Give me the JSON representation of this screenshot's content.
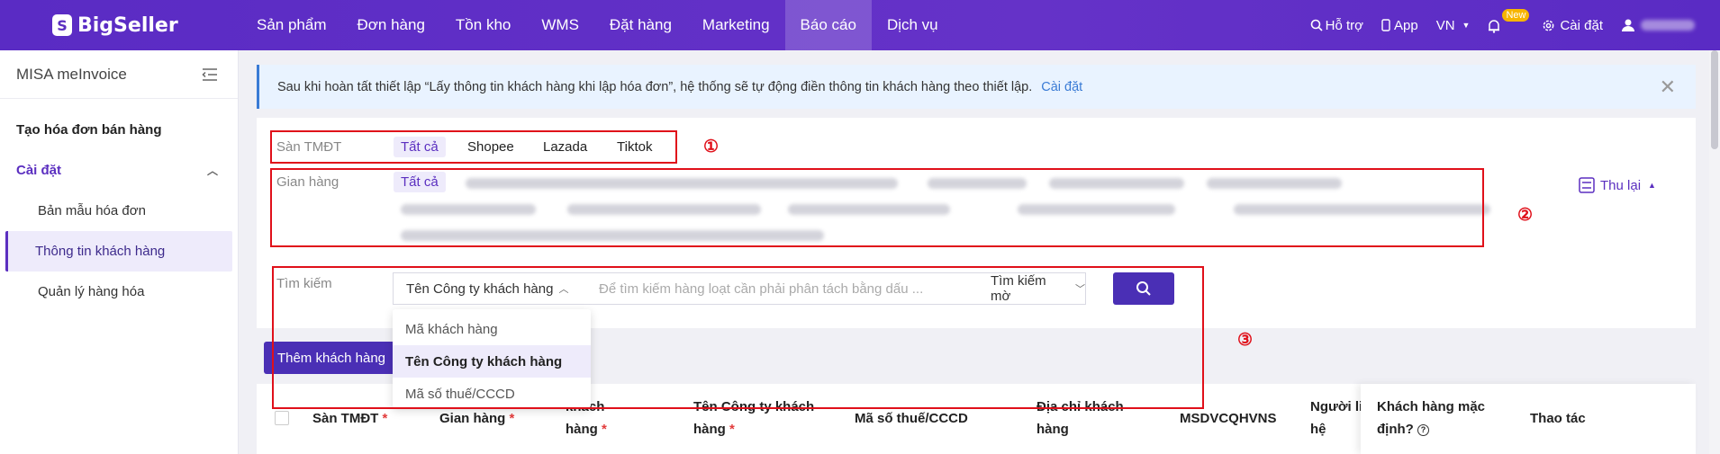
{
  "brand": {
    "name": "BigSeller"
  },
  "nav": {
    "items": [
      "Sản phẩm",
      "Đơn hàng",
      "Tồn kho",
      "WMS",
      "Đặt hàng",
      "Marketing",
      "Báo cáo",
      "Dịch vụ"
    ],
    "active": "Báo cáo",
    "help": "Hỗ trợ",
    "app": "App",
    "lang": "VN",
    "new_badge": "New",
    "settings": "Cài đặt"
  },
  "sidebar": {
    "title": "MISA meInvoice",
    "create_invoice": "Tạo hóa đơn bán hàng",
    "settings_group": "Cài đặt",
    "sub_items": [
      "Bản mẫu hóa đơn",
      "Thông tin khách hàng",
      "Quản lý hàng hóa"
    ],
    "active_sub": "Thông tin khách hàng"
  },
  "alert": {
    "text": "Sau khi hoàn tất thiết lập “Lấy thông tin khách hàng khi lập hóa đơn”, hệ thống sẽ tự động điền thông tin khách hàng theo thiết lập.",
    "link": "Cài đặt"
  },
  "filters": {
    "platform_label": "Sàn TMĐT",
    "platforms": [
      "Tất cả",
      "Shopee",
      "Lazada",
      "Tiktok"
    ],
    "store_label": "Gian hàng",
    "store_all": "Tất cả",
    "collapse_label": "Thu lại",
    "search_label": "Tìm kiếm",
    "search_field": "Tên Công ty khách hàng",
    "search_placeholder": "Để tìm kiếm hàng loạt cần phải phân tách bằng dấu ...",
    "search_mode": "Tìm kiếm mờ",
    "field_options": [
      "Mã khách hàng",
      "Tên Công ty khách hàng",
      "Mã số thuế/CCCD"
    ]
  },
  "actions": {
    "add_customer": "Thêm khách hàng"
  },
  "table": {
    "headers": {
      "platform": "Sàn TMĐT",
      "store": "Gian hàng",
      "customer_code_1": "khách",
      "customer_code_2": "hàng",
      "company_1": "Tên Công ty khách",
      "company_2": "hàng",
      "tax": "Mã số thuế/CCCD",
      "address_1": "Địa chỉ khách",
      "address_2": "hàng",
      "msdvcqhvns": "MSDVCQHVNS",
      "contact_1": "Người liên",
      "contact_2": "hệ",
      "default_1": "Khách hàng mặc",
      "default_2": "định?",
      "actions": "Thao tác"
    },
    "required_mark": "*"
  },
  "annotations": [
    "①",
    "②",
    "③"
  ],
  "colors": {
    "brand": "#5b2fc0",
    "annotation": "#e0101a"
  }
}
